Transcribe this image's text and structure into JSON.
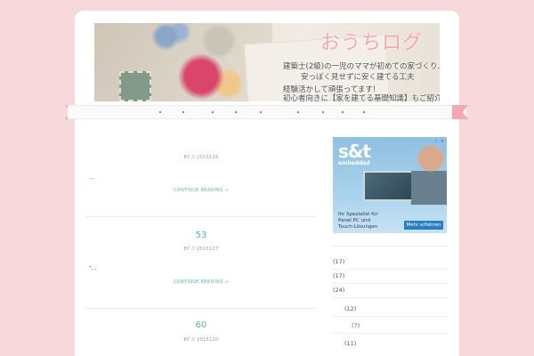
{
  "header": {
    "site_title": "おうちログ",
    "tagline_1": "建築士(2級)の一児のママが初めての家づくり…。",
    "tagline_2": "安っぽく見せずに安く建てる工夫",
    "tagline_3": "経験活かして頑張ってます!",
    "tagline_4": "初心者向きに【家を建てる基礎知識】もご紹介!"
  },
  "posts": [
    {
      "title": "",
      "by": "BY  //  2015126",
      "excerpt": "...",
      "more": "CONTINUE READING →"
    },
    {
      "title": "53",
      "by": "BY  //  2015127",
      "excerpt": "\"...",
      "more": "CONTINUE READING →"
    },
    {
      "title": "60",
      "by": "BY  //  2015120",
      "excerpt": "",
      "more": ""
    }
  ],
  "ad": {
    "brand": "s&t",
    "sub": "embedded",
    "line1": "Ihr Spezialist für",
    "line2": "Panel PC und",
    "line3": "Touch-Lösungen",
    "button": "Mehr erfahren",
    "close": "×",
    "info": "i"
  },
  "archives": [
    "(17)",
    "(17)",
    "(24)",
    "(12)",
    "(7)",
    "(11)"
  ],
  "colors": {
    "background": "#f7d9dc",
    "accent": "#55b9a3",
    "ribbon": "#f4a7b4"
  }
}
